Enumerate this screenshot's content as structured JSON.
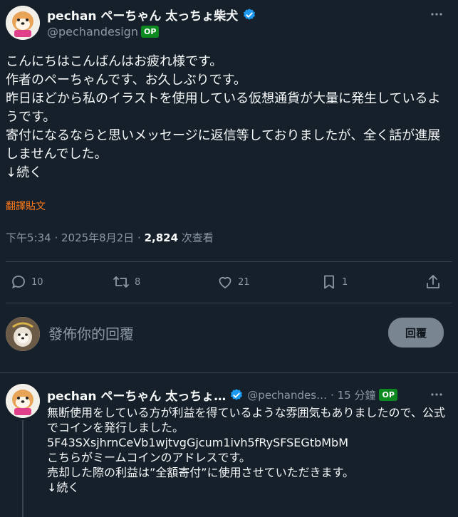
{
  "main_tweet": {
    "author_name": "pechan ペーちゃん 太っちょ柴犬",
    "handle": "@pechandesign",
    "op_badge": "OP",
    "body": "こんにちはこんばんはお疲れ様です。\n作者のペーちゃんです、お久しぶりです。\n昨日ほどから私のイラストを使用している仮想通貨が大量に発生しているようです。\n寄付になるならと思いメッセージに返信等しておりましたが、全く話が進展しませんでした。\n↓続く",
    "translate_label": "翻譯貼文",
    "time": "下午5:34 · 2025年8月2日 · ",
    "views": "2,824",
    "views_label": " 次查看"
  },
  "actions": {
    "replies": "10",
    "retweets": "8",
    "likes": "21",
    "bookmarks": "1"
  },
  "composer": {
    "placeholder": "發佈你的回覆",
    "reply_button": "回覆"
  },
  "reply_tweet": {
    "author_name": "pechan ペーちゃん 太っちょ…",
    "handle": "@pechandes…",
    "time": "· 15 分鐘",
    "op_badge": "OP",
    "body": "無断使用をしている方が利益を得ているような雰囲気もありましたので、公式でコインを発行しました。\n5F43SXsjhrnCeVb1wjtvgGjcum1ivh5fRySFSEGtbMbM\nこちらがミームコインのアドレスです。\n売却した際の利益は”全額寄付”に使用させていただきます。\n↓続く"
  },
  "colors": {
    "background": "#15202b",
    "text": "#f7f9f9",
    "muted": "#8b98a5",
    "verified": "#1d9bf0",
    "op_badge": "#0d8a1f",
    "translate": "#ff7a1a"
  }
}
